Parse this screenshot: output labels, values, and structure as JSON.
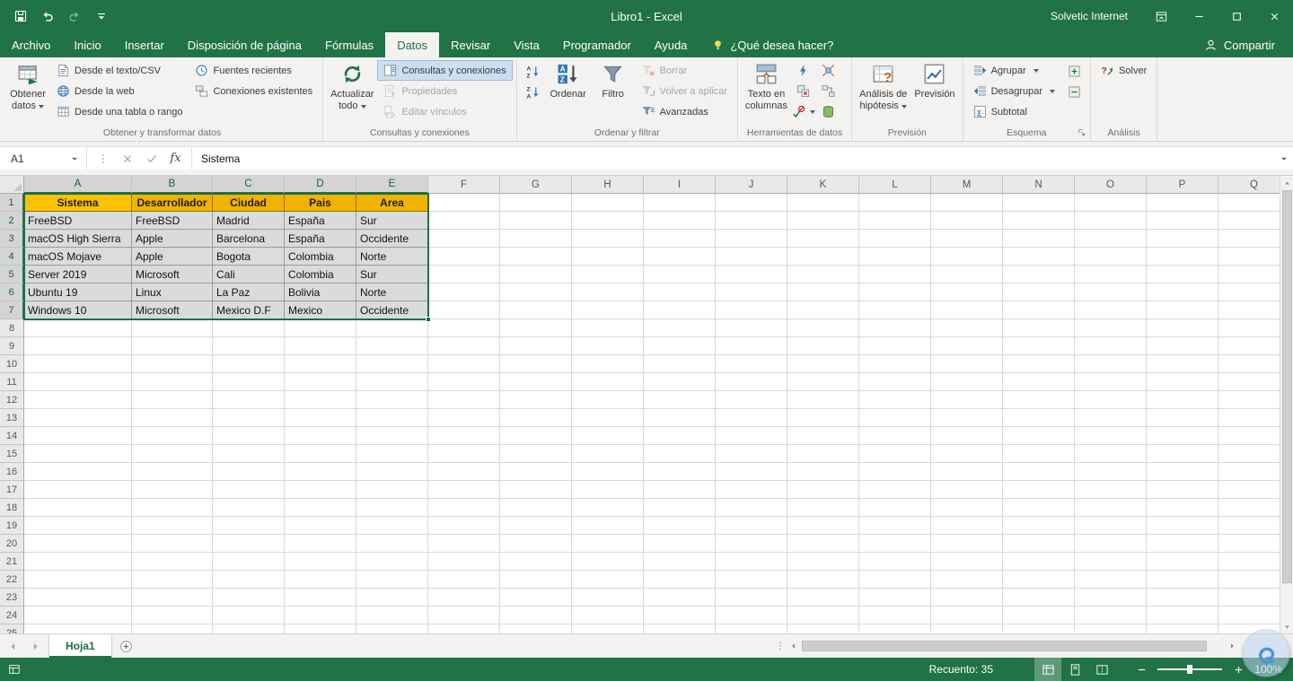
{
  "colors": {
    "excel_green": "#217346",
    "table_header_fill": "#f1b300",
    "selection_fill": "#d9dbdd",
    "selection_border": "#1e6f44"
  },
  "title_bar": {
    "title": "Libro1  -  Excel",
    "user": "Solvetic Internet"
  },
  "ribbon_tabs": [
    {
      "label": "Archivo"
    },
    {
      "label": "Inicio"
    },
    {
      "label": "Insertar"
    },
    {
      "label": "Disposición de página"
    },
    {
      "label": "Fórmulas"
    },
    {
      "label": "Datos",
      "active": true
    },
    {
      "label": "Revisar"
    },
    {
      "label": "Vista"
    },
    {
      "label": "Programador"
    },
    {
      "label": "Ayuda"
    }
  ],
  "tell_me": "¿Qué desea hacer?",
  "share": "Compartir",
  "ribbon_groups": [
    {
      "label": "Obtener y transformar datos",
      "items": [
        {
          "type": "big",
          "lines": [
            "Obtener",
            "datos"
          ],
          "icon": "get-data",
          "dropdown": true
        },
        {
          "type": "col",
          "buttons": [
            {
              "label": "Desde el texto/CSV",
              "icon": "from-text-csv"
            },
            {
              "label": "Desde la web",
              "icon": "from-web"
            },
            {
              "label": "Desde una tabla o rango",
              "icon": "from-table-range"
            }
          ]
        },
        {
          "type": "col",
          "buttons": [
            {
              "label": "Fuentes recientes",
              "icon": "recent-sources"
            },
            {
              "label": "Conexiones existentes",
              "icon": "existing-connections"
            }
          ]
        }
      ]
    },
    {
      "label": "Consultas y conexiones",
      "items": [
        {
          "type": "big",
          "lines": [
            "Actualizar",
            "todo"
          ],
          "icon": "refresh-all",
          "dropdown": true
        },
        {
          "type": "col",
          "buttons": [
            {
              "label": "Consultas y conexiones",
              "icon": "queries-connections",
              "selected": true
            },
            {
              "label": "Propiedades",
              "icon": "properties",
              "disabled": true
            },
            {
              "label": "Editar vínculos",
              "icon": "edit-links",
              "disabled": true
            }
          ]
        }
      ]
    },
    {
      "label": "Ordenar y filtrar",
      "items": [
        {
          "type": "stack",
          "buttons": [
            {
              "icon": "sort-az"
            },
            {
              "icon": "sort-za"
            }
          ]
        },
        {
          "type": "big",
          "lines": [
            "Ordenar"
          ],
          "icon": "sort"
        },
        {
          "type": "big",
          "lines": [
            "Filtro"
          ],
          "icon": "filter"
        },
        {
          "type": "col",
          "buttons": [
            {
              "label": "Borrar",
              "icon": "clear-filter",
              "disabled": true
            },
            {
              "label": "Volver a aplicar",
              "icon": "reapply",
              "disabled": true
            },
            {
              "label": "Avanzadas",
              "icon": "advanced-filter"
            }
          ]
        }
      ]
    },
    {
      "label": "Herramientas de datos",
      "items": [
        {
          "type": "big",
          "lines": [
            "Texto en",
            "columnas"
          ],
          "icon": "text-to-columns"
        },
        {
          "type": "icongrid",
          "buttons": [
            {
              "icon": "flash-fill"
            },
            {
              "icon": "remove-duplicates"
            },
            {
              "icon": "data-validation",
              "dropdown": true
            },
            {
              "icon": "consolidate"
            },
            {
              "icon": "relationships"
            },
            {
              "icon": "manage-data-model"
            }
          ]
        }
      ]
    },
    {
      "label": "Previsión",
      "items": [
        {
          "type": "big",
          "lines": [
            "Análisis de",
            "hipótesis"
          ],
          "icon": "what-if",
          "dropdown": true
        },
        {
          "type": "big",
          "lines": [
            "Previsión"
          ],
          "icon": "forecast-sheet"
        }
      ]
    },
    {
      "label": "Esquema",
      "dialog_launcher": true,
      "items": [
        {
          "type": "col",
          "buttons": [
            {
              "label": "Agrupar",
              "icon": "group",
              "dropdown": true
            },
            {
              "label": "Desagrupar",
              "icon": "ungroup",
              "dropdown": true
            },
            {
              "label": "Subtotal",
              "icon": "subtotal"
            }
          ]
        },
        {
          "type": "stack",
          "buttons": [
            {
              "icon": "show-detail"
            },
            {
              "icon": "hide-detail"
            }
          ]
        }
      ]
    },
    {
      "label": "Análisis",
      "items": [
        {
          "type": "col",
          "buttons": [
            {
              "label": "Solver",
              "icon": "solver"
            }
          ]
        }
      ]
    }
  ],
  "formula_bar": {
    "name_box": "A1",
    "fx": "fx",
    "value": "Sistema"
  },
  "grid": {
    "columns": [
      "A",
      "B",
      "C",
      "D",
      "E",
      "F",
      "G",
      "H",
      "I",
      "J",
      "K",
      "L",
      "M",
      "N",
      "O",
      "P",
      "Q"
    ],
    "selected_columns": [
      "A",
      "B",
      "C",
      "D",
      "E"
    ],
    "selected_rows": [
      1,
      2,
      3,
      4,
      5,
      6,
      7
    ],
    "visible_rows": 25,
    "selection": {
      "range": "A1:E7",
      "active_cell": "A1"
    },
    "table": {
      "headers": [
        "Sistema",
        "Desarrollador",
        "Ciudad",
        "Pais",
        "Area"
      ],
      "rows": [
        [
          "FreeBSD",
          "FreeBSD",
          "Madrid",
          "España",
          "Sur"
        ],
        [
          "macOS High Sierra",
          "Apple",
          "Barcelona",
          "España",
          "Occidente"
        ],
        [
          "macOS Mojave",
          "Apple",
          "Bogota",
          "Colombia",
          "Norte"
        ],
        [
          "Server 2019",
          "Microsoft",
          "Cali",
          "Colombia",
          "Sur"
        ],
        [
          "Ubuntu  19",
          "Linux",
          "La Paz",
          "Bolivia",
          "Norte"
        ],
        [
          "Windows 10",
          "Microsoft",
          "Mexico D.F",
          "Mexico",
          "Occidente"
        ]
      ]
    }
  },
  "sheet_bar": {
    "tabs": [
      {
        "label": "Hoja1",
        "active": true
      }
    ]
  },
  "status_bar": {
    "count": "Recuento: 35",
    "zoom": "100%"
  }
}
